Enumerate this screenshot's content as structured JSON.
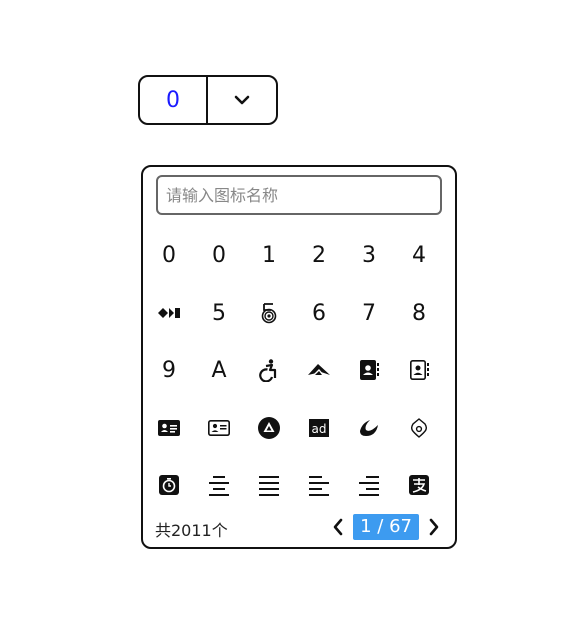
{
  "trigger": {
    "value": "0",
    "arrow_icon": "chevron-down-icon"
  },
  "search": {
    "placeholder": "请输入图标名称",
    "value": ""
  },
  "icons": [
    {
      "name": "0-icon",
      "text": "0"
    },
    {
      "name": "0-icon",
      "text": "0"
    },
    {
      "name": "1-icon",
      "text": "1"
    },
    {
      "name": "2-icon",
      "text": "2"
    },
    {
      "name": "3-icon",
      "text": "3"
    },
    {
      "name": "4-icon",
      "text": "4"
    },
    {
      "name": "42-group-icon",
      "text": ""
    },
    {
      "name": "5-icon",
      "text": "5"
    },
    {
      "name": "500px-icon",
      "text": ""
    },
    {
      "name": "6-icon",
      "text": "6"
    },
    {
      "name": "7-icon",
      "text": "7"
    },
    {
      "name": "8-icon",
      "text": "8"
    },
    {
      "name": "9-icon",
      "text": "9"
    },
    {
      "name": "a-icon",
      "text": "A"
    },
    {
      "name": "accessible-icon",
      "text": ""
    },
    {
      "name": "accusoft-icon",
      "text": ""
    },
    {
      "name": "address-book-icon",
      "text": ""
    },
    {
      "name": "address-book-outline-icon",
      "text": ""
    },
    {
      "name": "address-card-icon",
      "text": ""
    },
    {
      "name": "address-card-outline-icon",
      "text": ""
    },
    {
      "name": "adn-icon",
      "text": ""
    },
    {
      "name": "ad-icon",
      "text": "ad"
    },
    {
      "name": "adversal-icon",
      "text": ""
    },
    {
      "name": "airbnb-icon",
      "text": ""
    },
    {
      "name": "alarm-clock-icon",
      "text": ""
    },
    {
      "name": "align-center-icon",
      "text": ""
    },
    {
      "name": "align-justify-icon",
      "text": ""
    },
    {
      "name": "align-left-icon",
      "text": ""
    },
    {
      "name": "align-right-icon",
      "text": ""
    },
    {
      "name": "alipay-icon",
      "text": ""
    }
  ],
  "footer": {
    "count": "共2011个",
    "page": "1 / 67"
  }
}
